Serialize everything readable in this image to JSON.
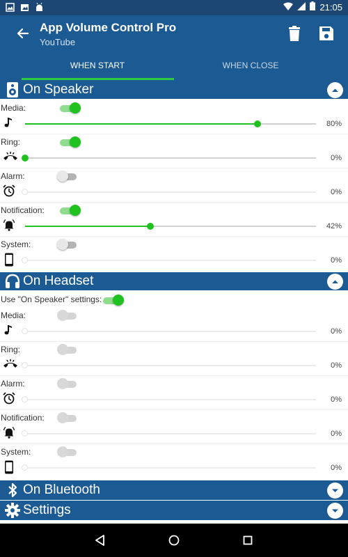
{
  "status_bar": {
    "time": "21:05"
  },
  "app_bar": {
    "title": "App Volume Control Pro",
    "subtitle": "YouTube"
  },
  "tabs": [
    {
      "label": "WHEN START"
    },
    {
      "label": "WHEN CLOSE"
    }
  ],
  "sections": {
    "speaker": {
      "label": "On Speaker"
    },
    "headset": {
      "label": "On Headset",
      "use_speaker_label": "Use \"On Speaker\" settings:"
    },
    "bluetooth": {
      "label": "On Bluetooth"
    },
    "settings": {
      "label": "Settings"
    }
  },
  "speaker_rows": [
    {
      "label": "Media:",
      "enabled": true,
      "percent": 80,
      "percent_text": "80%"
    },
    {
      "label": "Ring:",
      "enabled": true,
      "percent": 0,
      "percent_text": "0%"
    },
    {
      "label": "Alarm:",
      "enabled": false,
      "percent": 0,
      "percent_text": "0%"
    },
    {
      "label": "Notification:",
      "enabled": true,
      "percent": 42,
      "percent_text": "42%"
    },
    {
      "label": "System:",
      "enabled": false,
      "percent": 0,
      "percent_text": "0%"
    }
  ],
  "headset_rows": [
    {
      "label": "Media:",
      "enabled": false,
      "percent": 0,
      "percent_text": "0%"
    },
    {
      "label": "Ring:",
      "enabled": false,
      "percent": 0,
      "percent_text": "0%"
    },
    {
      "label": "Alarm:",
      "enabled": false,
      "percent": 0,
      "percent_text": "0%"
    },
    {
      "label": "Notification:",
      "enabled": false,
      "percent": 0,
      "percent_text": "0%"
    },
    {
      "label": "System:",
      "enabled": false,
      "percent": 0,
      "percent_text": "0%"
    }
  ],
  "headset_use_speaker_enabled": true,
  "colors": {
    "primary": "#1c5a94",
    "status_bar": "#1c4775",
    "accent": "#1fc21f",
    "tab_indicator": "#2ecc40"
  }
}
